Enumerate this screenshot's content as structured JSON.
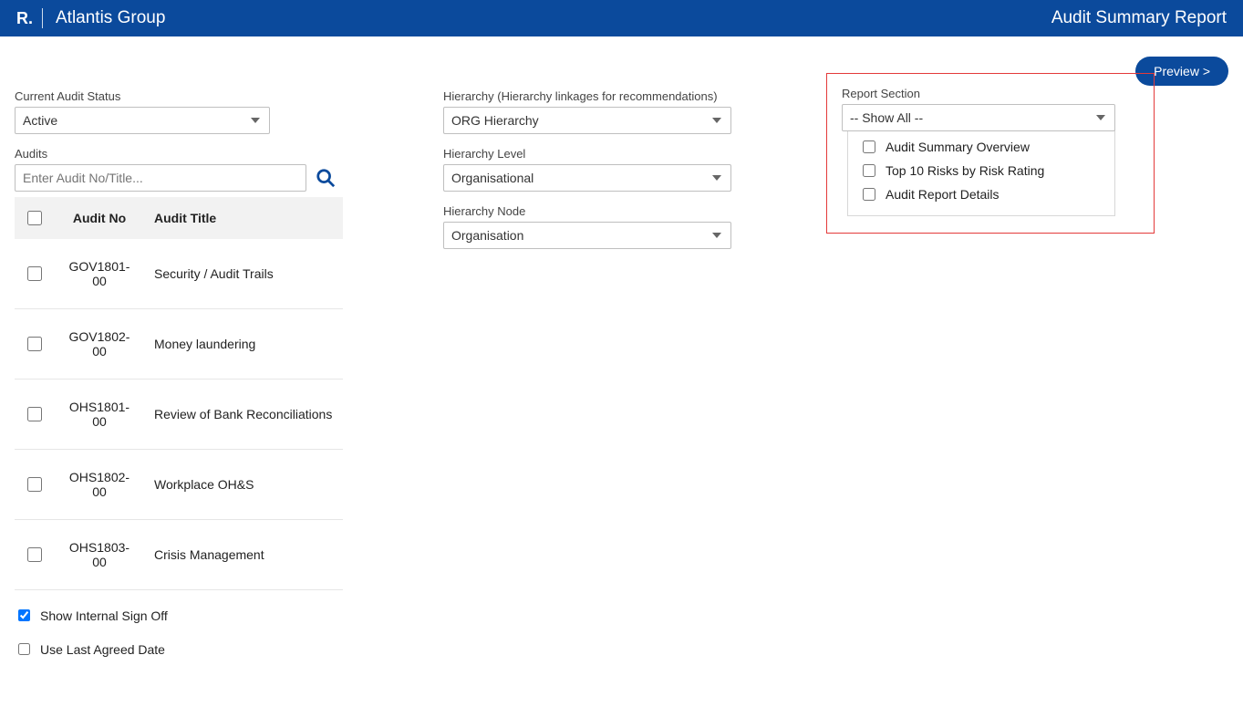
{
  "brand": {
    "mark": "R.",
    "label": "Atlantis Group"
  },
  "header_right": "Audit Summary Report",
  "preview_label": "Preview >",
  "left": {
    "status_label": "Current Audit Status",
    "status_value": "Active",
    "audits_label": "Audits",
    "search_placeholder": "Enter Audit No/Title...",
    "columns": {
      "no": "Audit No",
      "title": "Audit Title"
    },
    "rows": [
      {
        "no": "GOV1801-00",
        "title": "Security / Audit Trails"
      },
      {
        "no": "GOV1802-00",
        "title": "Money laundering"
      },
      {
        "no": "OHS1801-00",
        "title": "Review of Bank Reconciliations"
      },
      {
        "no": "OHS1802-00",
        "title": "Workplace OH&S"
      },
      {
        "no": "OHS1803-00",
        "title": "Crisis Management"
      }
    ],
    "show_signoff_label": "Show Internal Sign Off",
    "use_last_agreed_label": "Use Last Agreed Date"
  },
  "mid": {
    "hierarchy_label": "Hierarchy (Hierarchy linkages for recommendations)",
    "hierarchy_value": "ORG Hierarchy",
    "level_label": "Hierarchy Level",
    "level_value": "Organisational",
    "node_label": "Hierarchy Node",
    "node_value": "Organisation"
  },
  "right": {
    "section_label": "Report Section",
    "section_value": "-- Show All --",
    "options": [
      "Audit Summary Overview",
      "Top 10 Risks by Risk Rating",
      "Audit Report Details"
    ]
  }
}
